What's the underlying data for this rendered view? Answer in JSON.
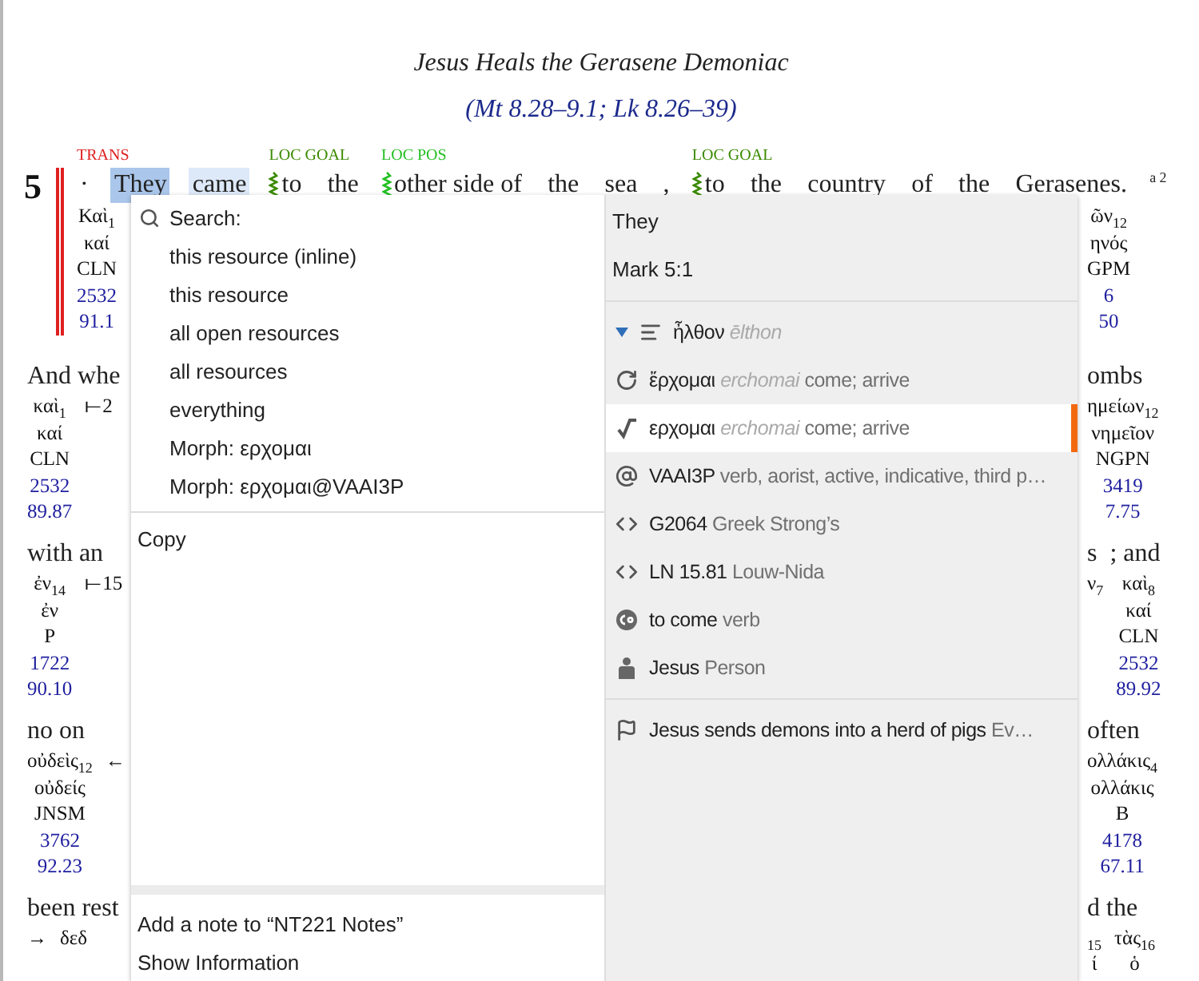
{
  "document": {
    "heading": "Jesus Heals the Gerasene Demoniac",
    "cross_reference": "(Mt 8.28–9.1; Lk 8.26–39)",
    "chapter": "5",
    "verse_words": [
      {
        "text": "·",
        "tag": "TRANS",
        "color": "#e02020"
      },
      {
        "text": "They",
        "selected": true
      },
      {
        "text": "came",
        "hovered": true
      },
      {
        "text": "to",
        "tag": "LOC GOAL",
        "color": "#3a8a00",
        "marker": true
      },
      {
        "text": "the"
      },
      {
        "text": "other side of",
        "tag": "LOC POS",
        "color": "#22c022",
        "marker": true
      },
      {
        "text": "the"
      },
      {
        "text": "sea"
      },
      {
        "text": ","
      },
      {
        "text": "to",
        "tag": "LOC GOAL",
        "color": "#3a8a00",
        "marker": true
      },
      {
        "text": "the"
      },
      {
        "text": "country"
      },
      {
        "text": "of"
      },
      {
        "text": "the"
      },
      {
        "text": "Gerasenes."
      }
    ],
    "note_marks": "a 2",
    "first_row": {
      "left_columns": [
        [
          "Καὶ$_{1}$",
          "καί",
          "CLN",
          "2532",
          "91.1"
        ]
      ],
      "right_columns": [
        [
          "ῶν$_{12}$",
          "ηνός",
          "GPM",
          "6",
          "50"
        ]
      ]
    },
    "rows": [
      {
        "left_english": "And whe",
        "left_columns": [
          [
            "καὶ$_{1}$",
            "καί",
            "CLN",
            "2532",
            "89.87"
          ],
          [
            "⟝2"
          ]
        ],
        "right_english": "ombs",
        "right_columns": [
          [
            "ημείων$_{12}$",
            "νημεῖον",
            "NGPN",
            "3419",
            "7.75"
          ]
        ]
      },
      {
        "left_english": "with an",
        "left_columns": [
          [
            "ἐν$_{14}$",
            "ἐν",
            "P",
            "1722",
            "90.10"
          ],
          [
            "⟝15"
          ]
        ],
        "right_english": "s  ; and",
        "right_columns": [
          [
            "ν$_{7}$"
          ],
          [
            "καὶ$_{8}$",
            "καί",
            "CLN",
            "2532",
            "89.92"
          ]
        ]
      },
      {
        "left_english": "no on",
        "left_columns": [
          [
            "οὐδεὶς$_{12}$",
            "οὐδείς",
            "JNSM",
            "3762",
            "92.23"
          ],
          [
            "←"
          ]
        ],
        "right_english": "often",
        "right_columns": [
          [
            "ολλάκις$_{4}$",
            "ολλάκις",
            "B",
            "4178",
            "67.11"
          ]
        ]
      },
      {
        "left_english": "been rest",
        "left_columns": [
          [
            "→"
          ],
          [
            "δεδ"
          ]
        ],
        "right_english": "d the",
        "right_columns": [
          [
            "$_{15}$",
            "ί"
          ],
          [
            "τὰς$_{16}$",
            "ὁ"
          ]
        ]
      }
    ]
  },
  "popup": {
    "search_label": "Search:",
    "search_options": [
      "this resource (inline)",
      "this resource",
      "all open resources",
      "all resources",
      "everything",
      "Morph: ερχομαι",
      "Morph: ερχομαι@VAAI3P"
    ],
    "copy": "Copy",
    "bottom_items": [
      "Add a note to “NT221 Notes”",
      "Show Information"
    ],
    "word": "They",
    "reference": "Mark 5:1",
    "sections": [
      {
        "items": [
          {
            "kind": "word",
            "expanded": true,
            "text": "ἦλθον",
            "translit": "ēlthon",
            "selected": false
          },
          {
            "kind": "lemma",
            "text": "ἔρχομαι",
            "translit": "erchomai",
            "gloss": "come; arrive",
            "selected": false
          },
          {
            "kind": "root",
            "text": "ερχομαι",
            "translit": "erchomai",
            "gloss": "come; arrive",
            "selected": true
          },
          {
            "kind": "morph",
            "text": "VAAI3P",
            "gloss": "verb, aorist, active, indicative, third p…",
            "selected": false
          },
          {
            "kind": "number",
            "text": "G2064",
            "gloss": "Greek Strong’s",
            "selected": false
          },
          {
            "kind": "number",
            "text": "LN 15.81",
            "gloss": "Louw-Nida",
            "selected": false
          },
          {
            "kind": "sense",
            "text": "to come",
            "gloss": "verb",
            "selected": false
          },
          {
            "kind": "person",
            "text": "Jesus",
            "gloss": "Person",
            "selected": false
          }
        ]
      },
      {
        "items": [
          {
            "kind": "event",
            "text": "Jesus sends demons into a herd of pigs",
            "gloss": "Ev…",
            "selected": false
          }
        ]
      }
    ]
  }
}
